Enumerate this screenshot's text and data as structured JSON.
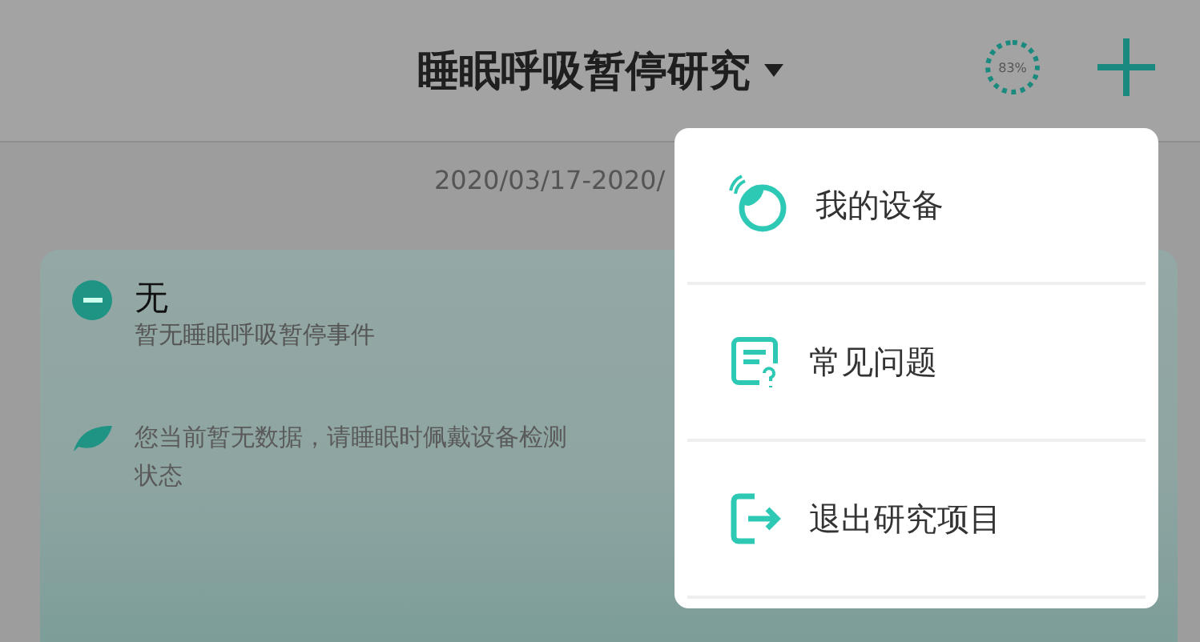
{
  "header": {
    "title": "睡眠呼吸暂停研究",
    "progress": "83%"
  },
  "date_range": "2020/03/17-2020/",
  "card": {
    "status": "无",
    "status_note": "暂无睡眠呼吸暂停事件",
    "tip_lines": [
      "您当前暂无数据，请睡眠时佩戴设备检测",
      "状态"
    ]
  },
  "menu": [
    {
      "kind": "device",
      "label": "我的设备"
    },
    {
      "kind": "faq",
      "label": "常见问题"
    },
    {
      "kind": "exit",
      "label": "退出研究项目"
    }
  ]
}
